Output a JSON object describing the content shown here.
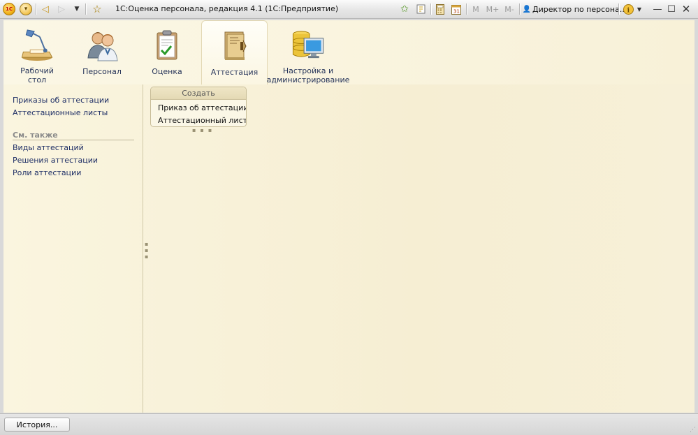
{
  "titlebar": {
    "app_title": "1С:Оценка персонала, редакция 4.1  (1С:Предприятие)",
    "logo_text": "1С",
    "user": "Директор по персона...",
    "memory_buttons": [
      "M",
      "M+",
      "M-"
    ],
    "icons": [
      "app-logo",
      "main-menu",
      "back-arrow",
      "forward-arrow",
      "history-dropdown",
      "favorites-star",
      "add-favorite",
      "bookmark",
      "calculator",
      "calendar",
      "user",
      "info",
      "minimize",
      "maximize",
      "close"
    ]
  },
  "sections": [
    {
      "label": "Рабочий стол",
      "icon": "desk-lamp-icon"
    },
    {
      "label": "Персонал",
      "icon": "people-icon"
    },
    {
      "label": "Оценка",
      "icon": "clipboard-check-icon"
    },
    {
      "label": "Аттестация",
      "icon": "folder-doc-icon",
      "active": true
    },
    {
      "label": "Настройка и администрирование",
      "icon": "database-monitor-icon"
    }
  ],
  "nav": {
    "links": [
      "Приказы об аттестации",
      "Аттестационные листы"
    ],
    "see_also_title": "См. также",
    "see_also": [
      "Виды аттестаций",
      "Решения аттестации",
      "Роли аттестации"
    ]
  },
  "create": {
    "title": "Создать",
    "items": [
      "Приказ об аттестации",
      "Аттестационный лист"
    ]
  },
  "statusbar": {
    "history_button": "История..."
  },
  "colors": {
    "workspace_bg": "#f8f2da",
    "link": "#1f2f66",
    "section_label": "#27355a"
  }
}
